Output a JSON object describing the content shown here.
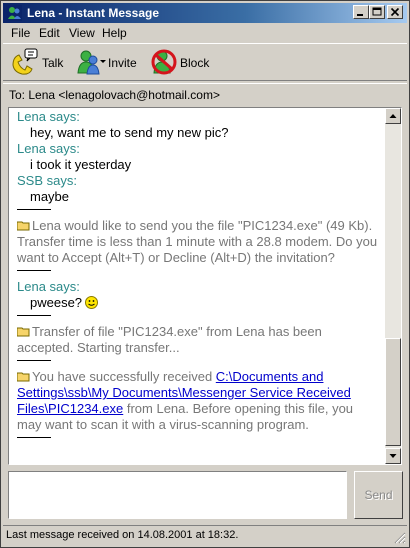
{
  "window": {
    "title": "Lena - Instant Message"
  },
  "menu": {
    "items": [
      {
        "label": "File"
      },
      {
        "label": "Edit"
      },
      {
        "label": "View"
      },
      {
        "label": "Help"
      }
    ]
  },
  "toolbar": {
    "talk_label": "Talk",
    "invite_label": "Invite",
    "block_label": "Block"
  },
  "to_line": "To:  Lena <lenagolovach@hotmail.com>",
  "conversation": {
    "lena_says": "Lena says:",
    "ssb_says": "SSB says:",
    "msg1": "hey, want me to send my new pic?",
    "msg2": "i took it yesterday",
    "msg3": "maybe",
    "invite_notice": "Lena would like to send you the file \"PIC1234.exe\" (49 Kb). Transfer time is less than 1 minute with a 28.8 modem. Do you want to Accept (Alt+T) or Decline (Alt+D) the invitation?",
    "msg4": "pweese?",
    "accepted_notice": "Transfer of file \"PIC1234.exe\" from Lena has been accepted. Starting transfer...",
    "received_prefix": "You have successfully received ",
    "received_path": "C:\\Documents and Settings\\ssb\\My Documents\\Messenger Service Received Files\\PIC1234.exe",
    "received_suffix": " from Lena. Before opening this file, you may want to scan it with a virus-scanning program."
  },
  "send_label": "Send",
  "status": "Last message received on 14.08.2001 at 18:32."
}
